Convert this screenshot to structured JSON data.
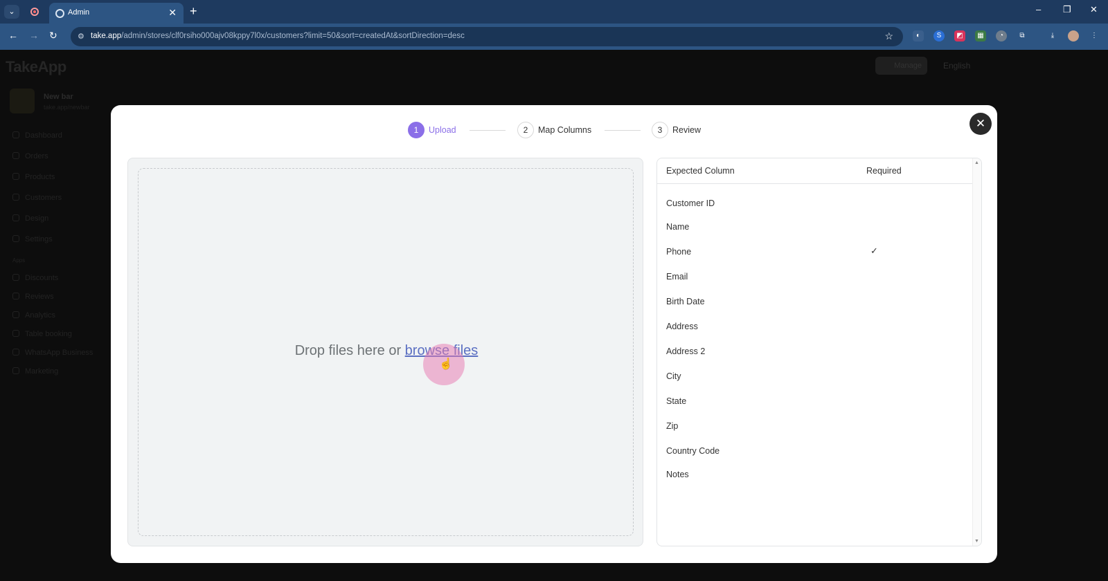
{
  "browser": {
    "tab_title": "Admin",
    "tab_close": "✕",
    "new_tab": "+",
    "url_host": "take.app",
    "url_path": "/admin/stores/clf0rsiho000ajv08kppy7l0x/customers?limit=50&sort=createdAt&sortDirection=desc",
    "minimize": "–",
    "restore": "❐",
    "close": "✕"
  },
  "app": {
    "logo": "TakeApp",
    "manage_label": "Manage",
    "language": "English",
    "store_name": "New bar",
    "store_subtitle": "take.app/newbar",
    "nav_items": [
      "Dashboard",
      "Orders",
      "Products",
      "Customers",
      "Design",
      "Settings",
      "Discounts",
      "Reviews",
      "Analytics",
      "Table booking",
      "WhatsApp Business",
      "Marketing"
    ],
    "section_label": "Apps"
  },
  "modal": {
    "close_symbol": "✕",
    "steps": [
      {
        "number": "1",
        "label": "Upload",
        "active": true
      },
      {
        "number": "2",
        "label": "Map Columns",
        "active": false
      },
      {
        "number": "3",
        "label": "Review",
        "active": false
      }
    ],
    "dropzone": {
      "text": "Drop files here or ",
      "link": "browse files"
    },
    "columns_table": {
      "headers": {
        "expected": "Expected Column",
        "required": "Required"
      },
      "rows": [
        {
          "name": "Customer ID",
          "required": false
        },
        {
          "name": "Name",
          "required": false
        },
        {
          "name": "Phone",
          "required": true
        },
        {
          "name": "Email",
          "required": false
        },
        {
          "name": "Birth Date",
          "required": false
        },
        {
          "name": "Address",
          "required": false
        },
        {
          "name": "Address 2",
          "required": false
        },
        {
          "name": "City",
          "required": false
        },
        {
          "name": "State",
          "required": false
        },
        {
          "name": "Zip",
          "required": false
        },
        {
          "name": "Country Code",
          "required": false
        },
        {
          "name": "Notes",
          "required": false
        }
      ],
      "check_symbol": "✓"
    }
  },
  "colors": {
    "accent": "#8b6fe8",
    "link": "#5b6fc2",
    "chrome_dark": "#1e3a5f",
    "chrome_light": "#2d5583"
  }
}
